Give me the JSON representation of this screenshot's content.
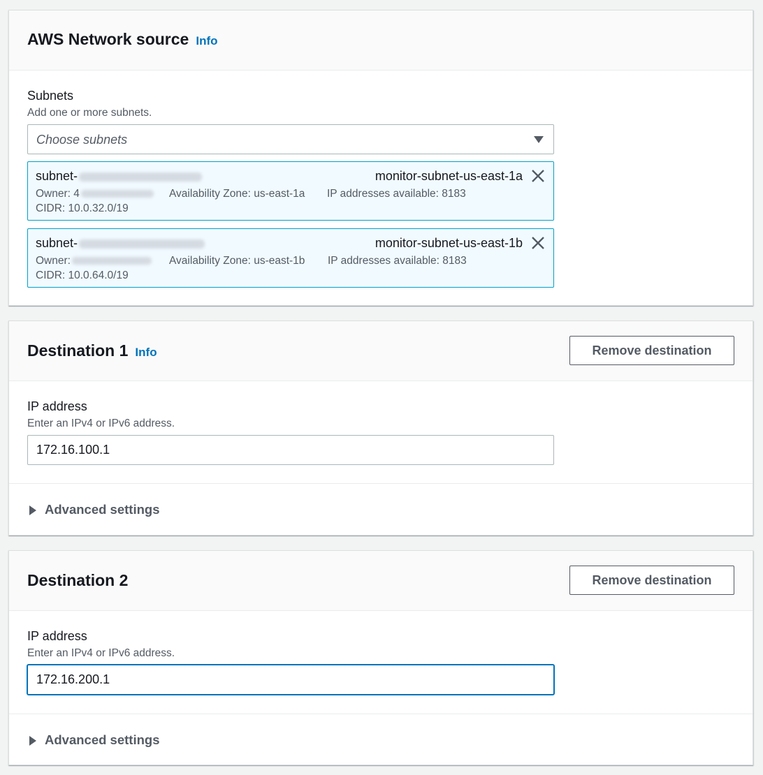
{
  "network_source": {
    "title": "AWS Network source",
    "info": "Info",
    "subnets_label": "Subnets",
    "subnets_desc": "Add one or more subnets.",
    "subnets_placeholder": "Choose subnets",
    "subnets": [
      {
        "id_prefix": "subnet-",
        "name": "monitor-subnet-us-east-1a",
        "owner_label": "Owner: 4",
        "availability_zone": "Availability Zone: us-east-1a",
        "ip_available": "IP addresses available: 8183",
        "cidr": "CIDR: 10.0.32.0/19"
      },
      {
        "id_prefix": "subnet-",
        "name": "monitor-subnet-us-east-1b",
        "owner_label": "Owner:",
        "availability_zone": "Availability Zone: us-east-1b",
        "ip_available": "IP addresses available: 8183",
        "cidr": "CIDR: 10.0.64.0/19"
      }
    ]
  },
  "destinations": [
    {
      "title": "Destination 1",
      "info": "Info",
      "remove_label": "Remove destination",
      "ip_label": "IP address",
      "ip_desc": "Enter an IPv4 or IPv6 address.",
      "ip_value": "172.16.100.1",
      "advanced_label": "Advanced settings"
    },
    {
      "title": "Destination 2",
      "remove_label": "Remove destination",
      "ip_label": "IP address",
      "ip_desc": "Enter an IPv4 or IPv6 address.",
      "ip_value": "172.16.200.1",
      "advanced_label": "Advanced settings"
    }
  ],
  "colors": {
    "link": "#0073bb",
    "token_bg": "#f1faff",
    "token_border": "#00a1c9",
    "focus": "#0073bb"
  }
}
